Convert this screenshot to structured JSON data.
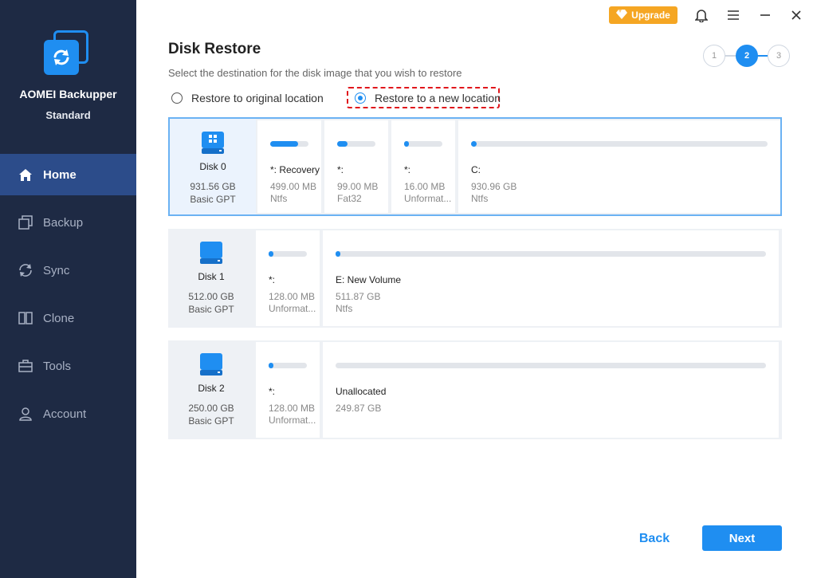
{
  "app": {
    "name": "AOMEI Backupper",
    "edition": "Standard"
  },
  "titlebar": {
    "upgrade_label": "Upgrade"
  },
  "nav": [
    {
      "label": "Home",
      "icon": "home-icon",
      "active": true
    },
    {
      "label": "Backup",
      "icon": "backup-icon"
    },
    {
      "label": "Sync",
      "icon": "sync-icon"
    },
    {
      "label": "Clone",
      "icon": "clone-icon"
    },
    {
      "label": "Tools",
      "icon": "tools-icon"
    },
    {
      "label": "Account",
      "icon": "account-icon"
    }
  ],
  "page": {
    "title": "Disk Restore",
    "subtitle": "Select the destination for the disk image that you wish to restore"
  },
  "steps": [
    "1",
    "2",
    "3"
  ],
  "active_step": 2,
  "options": {
    "original": "Restore to original location",
    "new": "Restore to a new location",
    "selected": "new"
  },
  "disks": [
    {
      "name": "Disk 0",
      "size": "931.56 GB",
      "type": "Basic GPT",
      "partitions": [
        {
          "label": "*: Recovery",
          "size": "499.00 MB",
          "fs": "Ntfs",
          "used": 0.72
        },
        {
          "label": "*:",
          "size": "99.00 MB",
          "fs": "Fat32",
          "used": 0.28
        },
        {
          "label": "*:",
          "size": "16.00 MB",
          "fs": "Unformat...",
          "used": 0.05
        },
        {
          "label": "C:",
          "size": "930.96 GB",
          "fs": "Ntfs",
          "used": 0.02
        }
      ]
    },
    {
      "name": "Disk 1",
      "size": "512.00 GB",
      "type": "Basic GPT",
      "partitions": [
        {
          "label": "*:",
          "size": "128.00 MB",
          "fs": "Unformat...",
          "used": 0.05
        },
        {
          "label": "E: New Volume",
          "size": "511.87 GB",
          "fs": "Ntfs",
          "used": 0.01
        }
      ]
    },
    {
      "name": "Disk 2",
      "size": "250.00 GB",
      "type": "Basic GPT",
      "partitions": [
        {
          "label": "*:",
          "size": "128.00 MB",
          "fs": "Unformat...",
          "used": 0.05
        },
        {
          "label": "Unallocated",
          "size": "249.87 GB",
          "fs": "",
          "used": 0.0
        }
      ]
    }
  ],
  "footer": {
    "back": "Back",
    "next": "Next"
  },
  "colors": {
    "accent": "#1f8ef1",
    "sidebar": "#1e2a44",
    "nav_active": "#2c4c8a",
    "upgrade": "#f5a623",
    "highlight": "#e0161b"
  }
}
